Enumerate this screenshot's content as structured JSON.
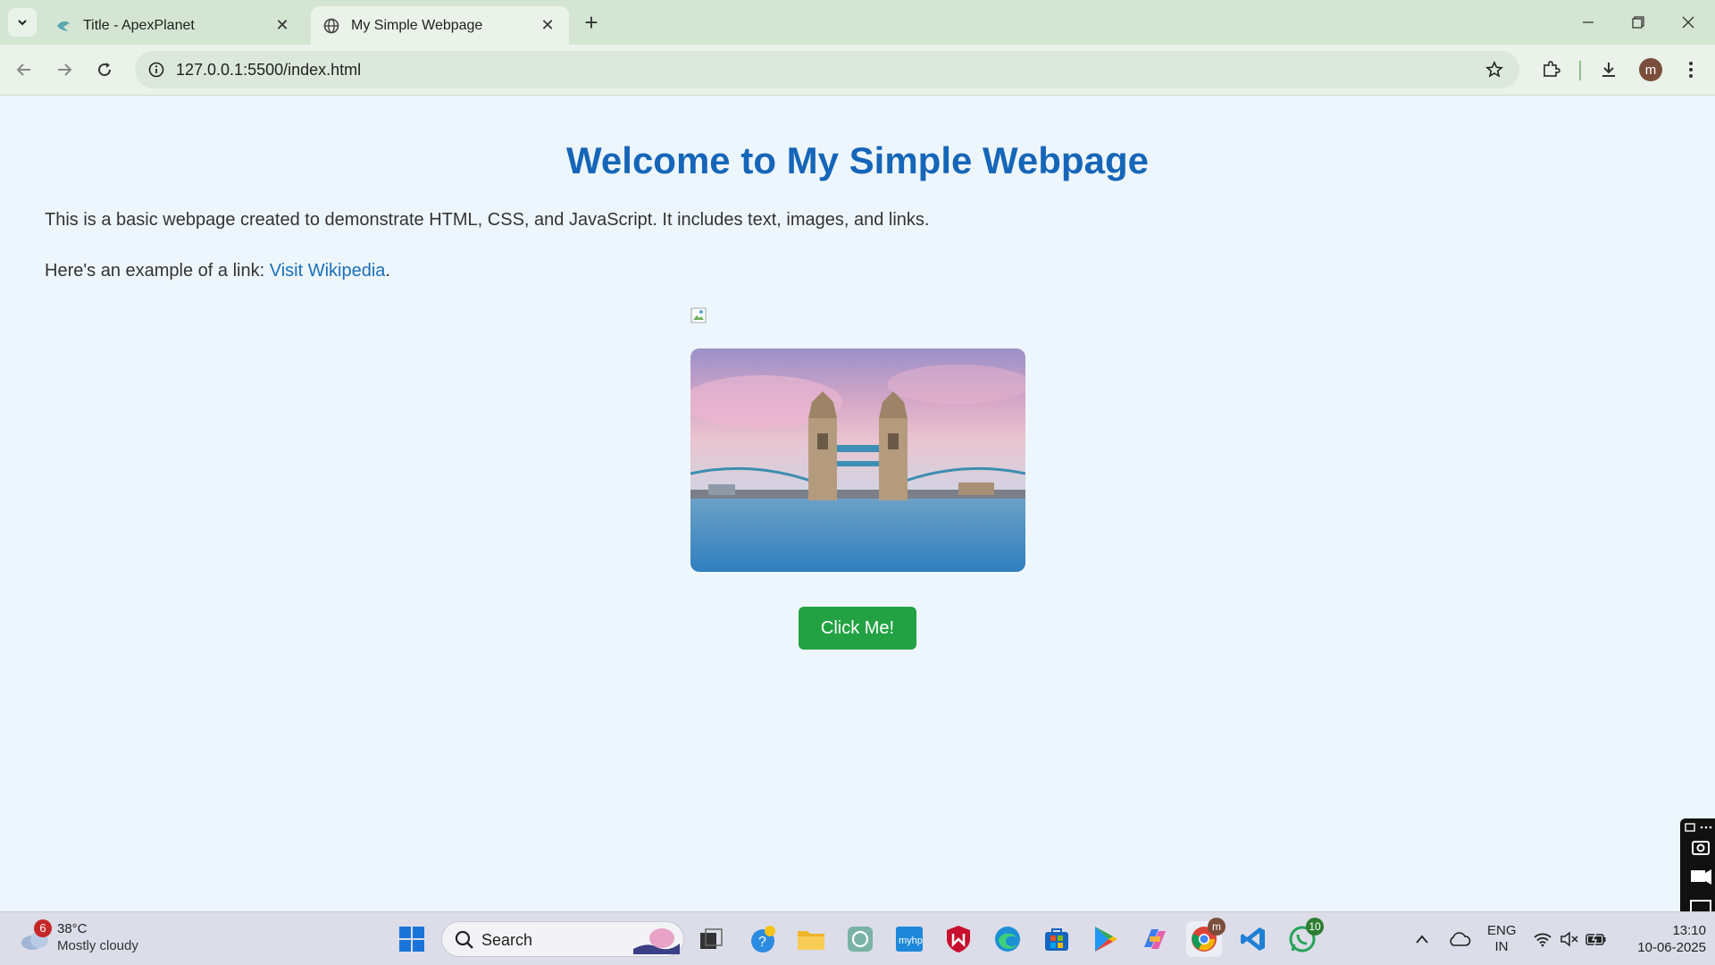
{
  "browser": {
    "tabs": [
      {
        "title": "Title - ApexPlanet",
        "active": false
      },
      {
        "title": "My Simple Webpage",
        "active": true
      }
    ],
    "url": "127.0.0.1:5500/index.html",
    "profile_initial": "m"
  },
  "page": {
    "heading": "Welcome to My Simple Webpage",
    "intro": "This is a basic webpage created to demonstrate HTML, CSS, and JavaScript. It includes text, images, and links.",
    "link_prefix": "Here's an example of a link: ",
    "link_text": "Visit Wikipedia",
    "link_suffix": ".",
    "button_label": "Click Me!"
  },
  "taskbar": {
    "weather_temp": "38°C",
    "weather_condition": "Mostly cloudy",
    "weather_badge": "6",
    "search_label": "Search",
    "lang_line1": "ENG",
    "lang_line2": "IN",
    "time": "13:10",
    "date": "10-06-2025",
    "whatsapp_badge": "10",
    "chrome_badge": "m"
  },
  "colors": {
    "heading": "#1566b8",
    "link": "#1a6fb9",
    "button": "#22a243",
    "page_bg": "#eef6fd"
  }
}
